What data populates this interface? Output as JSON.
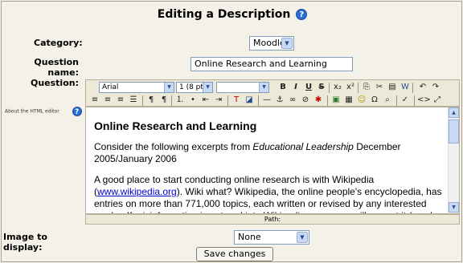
{
  "page": {
    "title": "Editing a Description"
  },
  "category": {
    "label": "Category:",
    "value": "Moodle"
  },
  "question_name": {
    "label": "Question name:",
    "value": "Online Research and Learning"
  },
  "question": {
    "label": "Question:"
  },
  "html_editor": {
    "help_link": "About the HTML editor",
    "font": "Arial",
    "size": "1 (8 pt)",
    "style": "",
    "content": {
      "heading": "Online Research and Learning",
      "p1_prefix": "Consider the following excerpts from ",
      "p1_italic": "Educational Leadership",
      "p1_suffix": " December 2005/January 2006",
      "p2_prefix": "A good place to start conducting online research is with Wikipedia (",
      "p2_link": "www.wikipedia.org",
      "p2_suffix": "). Wiki what? Wikipedia, the online people's encyclopedia, has entries on more than 771,000 topics, each written or revised by any interested reader. If misinformation is entered into Wikipedia, someone will correct it (maybe"
    },
    "path_label": "Path:"
  },
  "image": {
    "label": "Image to display:",
    "value": "None"
  },
  "save_button": "Save changes",
  "help_icon_glyph": "?"
}
